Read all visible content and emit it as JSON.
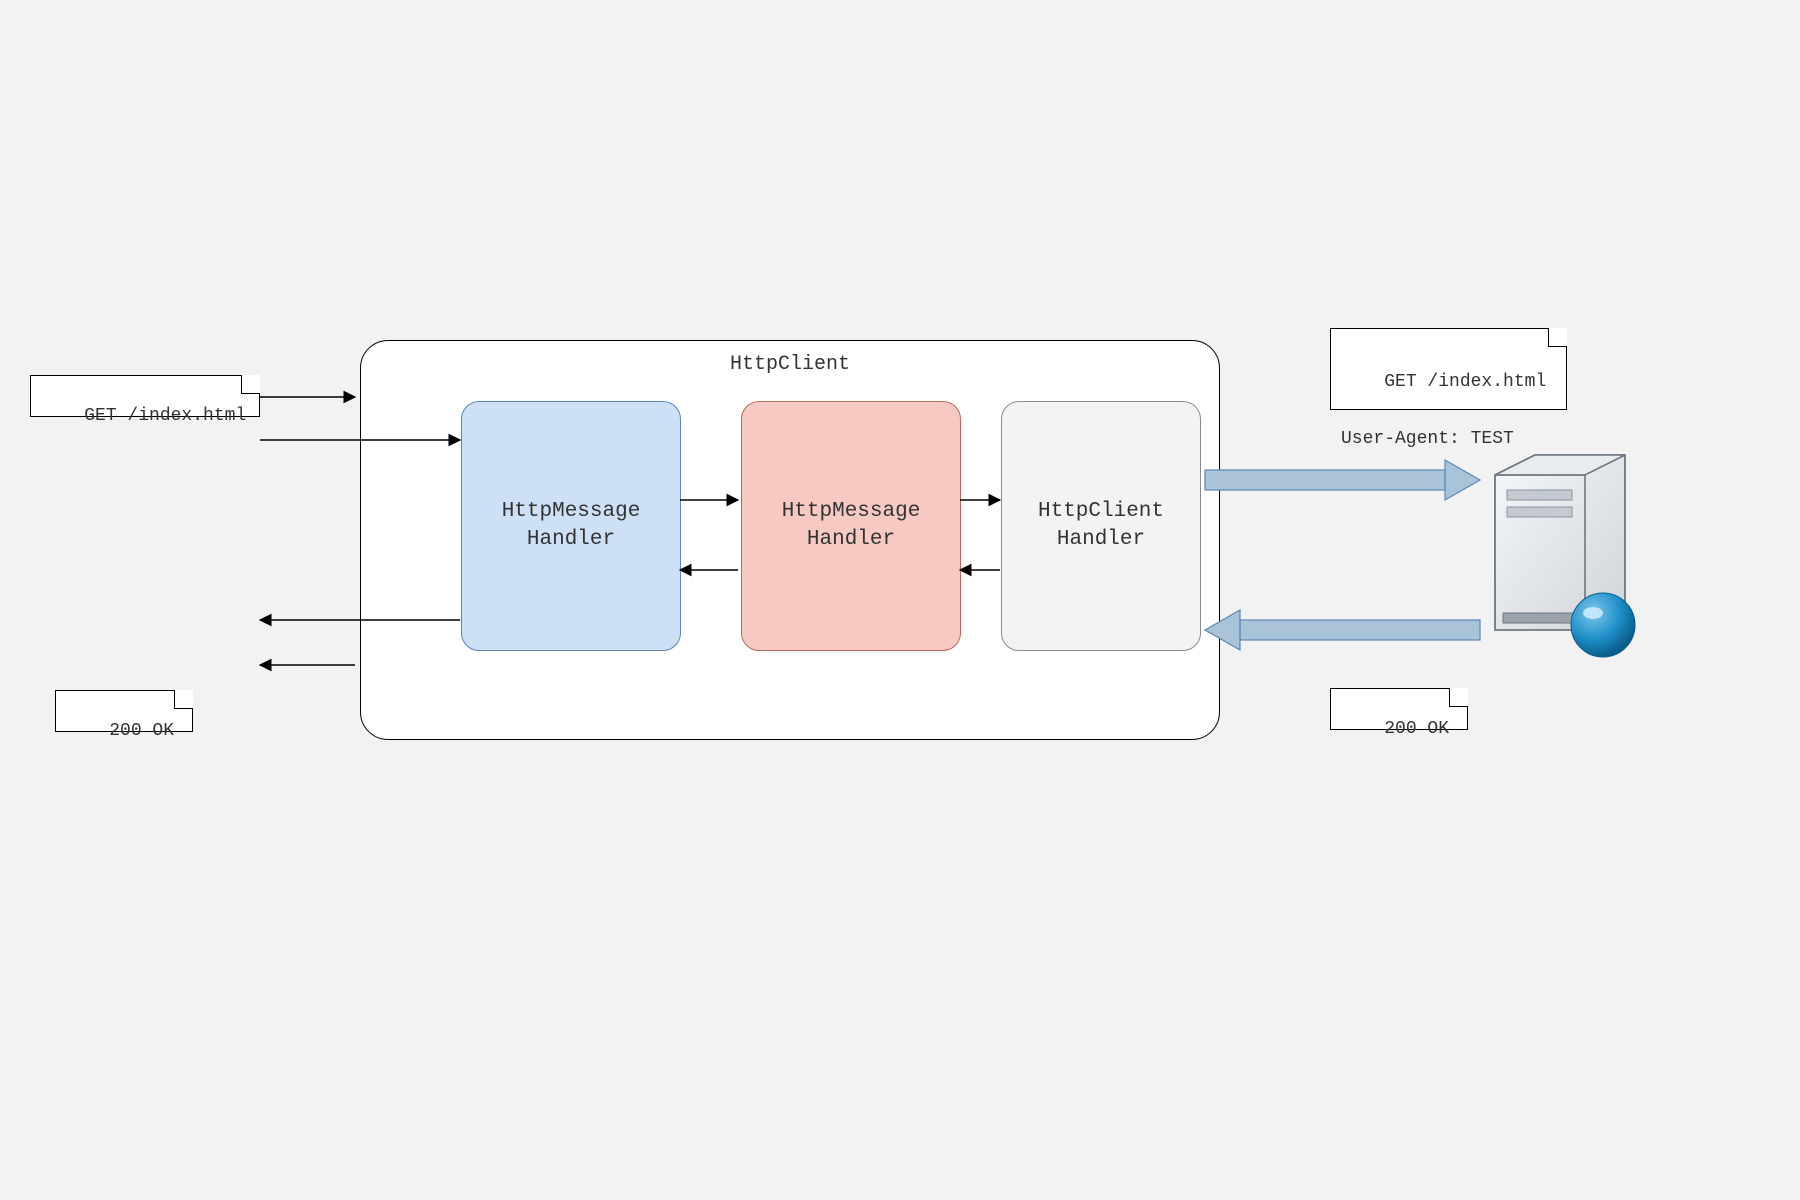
{
  "container": {
    "title": "HttpClient"
  },
  "handlers": {
    "blue": {
      "label": "HttpMessage\nHandler"
    },
    "red": {
      "label": "HttpMessage\nHandler"
    },
    "grey": {
      "label": "HttpClient\nHandler"
    }
  },
  "notes": {
    "request_left": "GET /index.html",
    "response_left": "200 OK",
    "request_right": "GET /index.html\n\nUser-Agent: TEST",
    "response_right": "200 OK"
  }
}
